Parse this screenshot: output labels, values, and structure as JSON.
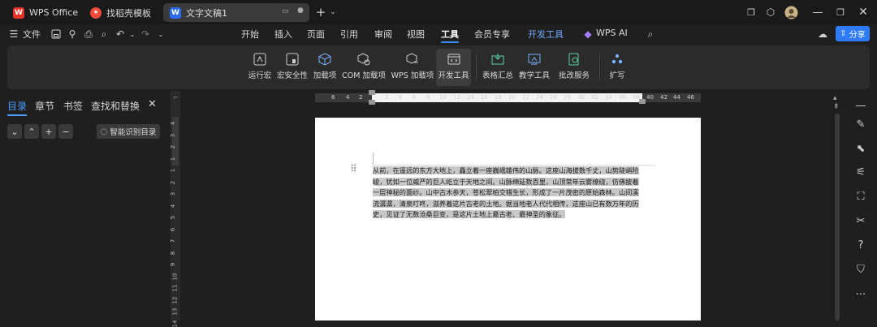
{
  "tabs": [
    {
      "label": "WPS Office",
      "icon": "wps-logo-icon"
    },
    {
      "label": "找稻壳模板",
      "icon": "docer-icon"
    },
    {
      "label": "文字文稿1",
      "icon": "word-doc-icon"
    }
  ],
  "menubar": {
    "file": "文件",
    "items": [
      "开始",
      "插入",
      "页面",
      "引用",
      "审阅",
      "视图",
      "工具",
      "会员专享",
      "开发工具",
      "WPS AI"
    ],
    "active": "工具",
    "share": "分享"
  },
  "ribbon": {
    "buttons": [
      "运行宏",
      "宏安全性",
      "加载项",
      "COM 加载项",
      "WPS 加载项",
      "开发工具",
      "表格汇总",
      "教学工具",
      "批改服务",
      "扩写"
    ],
    "active": "开发工具"
  },
  "left_panel": {
    "tabs": [
      "目录",
      "章节",
      "书签",
      "查找和替换"
    ],
    "active": "目录",
    "smart_button": "智能识别目录"
  },
  "ruler": {
    "h_numbers": [
      "6",
      "4",
      "2",
      "2",
      "4",
      "6",
      "8",
      "10",
      "12",
      "14",
      "16",
      "18",
      "20",
      "22",
      "24",
      "26",
      "28",
      "30",
      "32",
      "34",
      "36",
      "38",
      "40",
      "42",
      "44",
      "46"
    ],
    "v_numbers": [
      "4",
      "3",
      "2",
      "1",
      "1",
      "2",
      "3",
      "4",
      "5",
      "6",
      "7",
      "8",
      "9",
      "10",
      "11",
      "12",
      "13",
      "14"
    ]
  },
  "document": {
    "lines": [
      "从前，在遥远的东方大地上，矗立着一座巍峨雄伟的山脉。这座山海拔数千丈，山势陡峭险",
      "峻，犹如一位威严的巨人屹立于天地之间。山脉绵延数百里，山顶常年云雾缭绕，仿佛披着",
      "一层神秘的面纱。山中古木参天，苍松翠柏交错生长，形成了一片茂密的原始森林。山间溪",
      "流潺潺，清泉叮咚，滋养着这片古老的土地。据当地老人代代相传，这座山已有数万年的历",
      "史，见证了无数沧桑巨变，是这片土地上最古老、最神圣的象征。"
    ]
  }
}
